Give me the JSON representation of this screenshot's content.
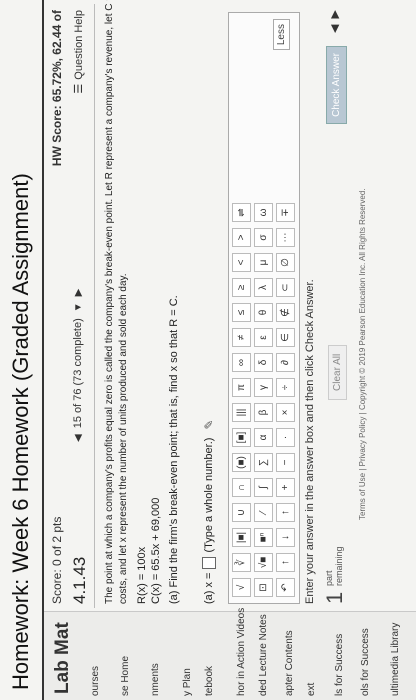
{
  "header": {
    "title": "Homework: Week 6 Homework (Graded Assignment)"
  },
  "sidebar": {
    "title": "Lab Mat",
    "items": [
      {
        "label": "ourses"
      },
      {
        "label": "se Home"
      },
      {
        "label": "nments"
      },
      {
        "label": "y Plan"
      },
      {
        "label": "tebook"
      },
      {
        "label": "hor in Action Videos"
      },
      {
        "label": "ded Lecture Notes"
      },
      {
        "label": "apter Contents"
      },
      {
        "label": "ext"
      },
      {
        "label": "ls for Success"
      },
      {
        "label": "ols for Success"
      },
      {
        "label": "ultimedia Library"
      }
    ]
  },
  "score": {
    "label": "Score: 0 of 2 pts"
  },
  "hw_score": {
    "label": "HW Score: 65.72%, 62.44 of"
  },
  "question": {
    "id": "4.1.43",
    "nav_text": "15 of 76 (73 complete)",
    "help_label": "Question Help"
  },
  "problem": {
    "line1": "The point at which a company's profits equal zero is called the company's break-even point. Let R represent a company's revenue, let C represent the company's",
    "line2": "costs, and let x represent the number of units produced and sold each day.",
    "line3": "R(x) = 100x",
    "line4": "C(x) = 65.5x + 69,000",
    "part_a": "(a)  Find the firm's break-even point; that is, find x so that R = C.",
    "answer_prefix": "(a)  x =",
    "answer_hint": "(Type a whole number.)"
  },
  "palette": {
    "row1": [
      "√",
      "∛",
      "|■|",
      "∪",
      "∩",
      "(■)",
      "[■]",
      "|||",
      "π",
      "∞",
      "≠",
      "≤",
      "≥",
      "<",
      ">",
      "⇌"
    ],
    "row2": [
      "⊡",
      "√■",
      "■ⁿ",
      "⁄",
      "∫",
      "∑",
      "α",
      "β",
      "γ",
      "δ",
      "ε",
      "θ",
      "λ",
      "μ",
      "σ",
      "ω"
    ],
    "row3": [
      "↶",
      "↑",
      "↓",
      "↑",
      "+",
      "−",
      "·",
      "×",
      "÷",
      "∂",
      "∈",
      "∉",
      "⊂",
      "∅",
      "⋯",
      "∓"
    ],
    "less_label": "Less"
  },
  "instructions": "Enter your answer in the answer box and then click Check Answer.",
  "parts": {
    "count": "1",
    "label_line1": "part",
    "label_line2": "remaining"
  },
  "buttons": {
    "clear_all": "Clear All",
    "check_answer": "Check Answer"
  },
  "footer": "Terms of Use | Privacy Policy | Copyright © 2019 Pearson Education Inc. All Rights Reserved."
}
